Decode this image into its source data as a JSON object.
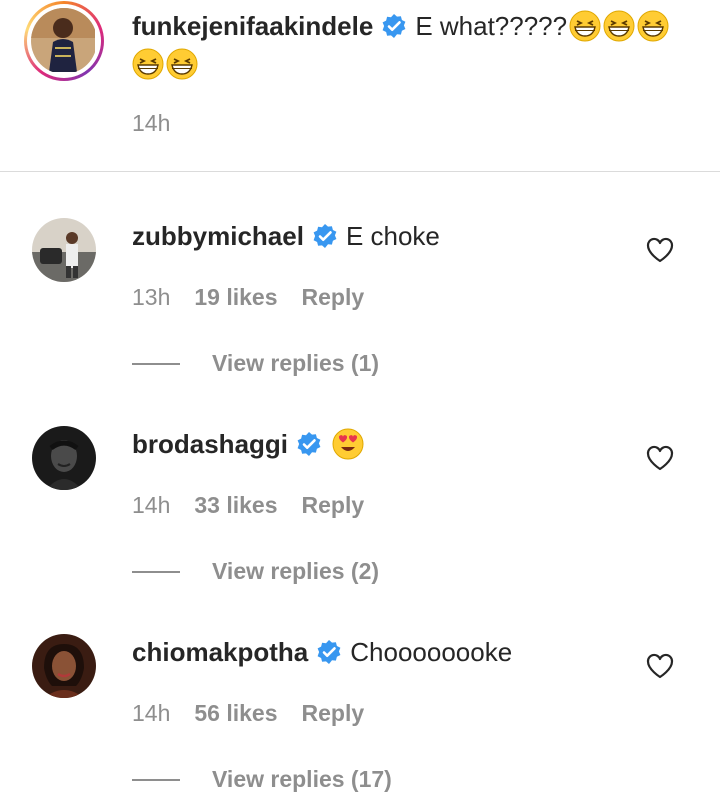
{
  "caption": {
    "username": "funkejenifaakindele",
    "text": "E what?????",
    "emoji": [
      "grinning-squint-emoji",
      "grinning-squint-emoji",
      "grinning-squint-emoji",
      "grinning-squint-emoji",
      "grinning-squint-emoji"
    ],
    "time": "14h"
  },
  "comments": [
    {
      "username": "zubbymichael",
      "text": "E choke",
      "time": "13h",
      "likes": "19 likes",
      "reply": "Reply",
      "view_replies": "View replies (1)"
    },
    {
      "username": "brodashaggi",
      "text": "",
      "emoji": "heart-eyes-emoji",
      "time": "14h",
      "likes": "33 likes",
      "reply": "Reply",
      "view_replies": "View replies (2)"
    },
    {
      "username": "chiomakpotha",
      "text": "Choooooooke",
      "time": "14h",
      "likes": "56 likes",
      "reply": "Reply",
      "view_replies": "View replies (17)"
    }
  ],
  "colors": {
    "verified": "#3897f0",
    "secondary_text": "#8e8e8e",
    "primary_text": "#262626",
    "divider": "#dbdbdb"
  }
}
